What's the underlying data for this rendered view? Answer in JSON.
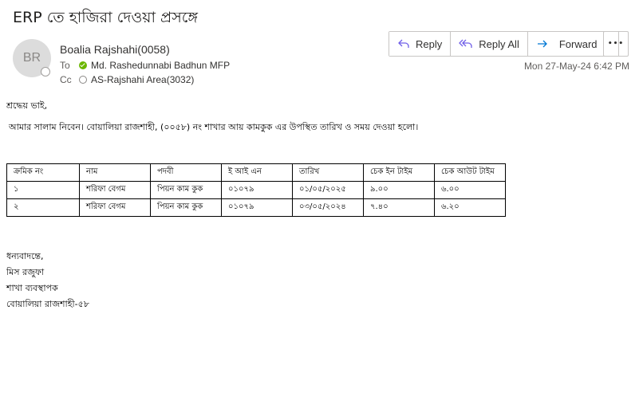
{
  "email": {
    "subject": "ERP তে হাজিরা দেওয়া প্রসঙ্গে",
    "avatar_initials": "BR",
    "sender": "Boalia Rajshahi(0058)",
    "to_label": "To",
    "to_name": "Md. Rashedunnabi Badhun MFP",
    "cc_label": "Cc",
    "cc_name": "AS-Rajshahi Area(3032)",
    "timestamp": "Mon 27-May-24 6:42 PM"
  },
  "actions": {
    "reply": "Reply",
    "reply_all": "Reply All",
    "forward": "Forward",
    "more": "•••"
  },
  "body": {
    "greeting": "শ্রদ্ধেয় ভাই,",
    "intro": "আমার সালাম নিবেন। বোয়ালিয়া রাজশাহী, (০০৫৮) নং শাখার আয় কামকুক এর উপস্থিত তারিখ ও সময় দেওয়া হলো।"
  },
  "table": {
    "headers": [
      "ক্রমিক নং",
      "নাম",
      "পদবী",
      "ই আই  এন",
      "তারিখ",
      "চেক ইন টাইম",
      "চেক আউট টাইম"
    ],
    "rows": [
      [
        "১",
        "শরিফা বেগম",
        "পিয়ন কাম কুক",
        "০১০৭৯",
        "০১/০৫/২০২৫",
        "৯.০০",
        "৬.০০"
      ],
      [
        "২",
        "শরিফা বেগম",
        "পিয়ন কাম কুক",
        "০১০৭৯",
        "০৩/০৫/২০২৪",
        "৭.৪০",
        "৬.২০"
      ]
    ]
  },
  "signature": {
    "line1": "ধন্যবাদন্তে,",
    "line2": "মিস রজুফা",
    "line3": "শাখা ব্যবস্থাপক",
    "line4": "বোয়ালিয়া রাজশাহী-৫৮"
  },
  "colors": {
    "accent": "#0078d4",
    "presence_available": "#6bb700",
    "avatar_bg": "#dcdcdc"
  }
}
